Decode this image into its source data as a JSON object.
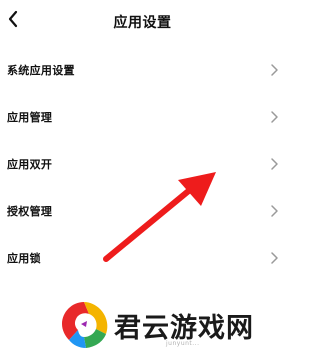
{
  "header": {
    "title": "应用设置",
    "back_icon": "chevron-left-icon"
  },
  "settings": {
    "items": [
      {
        "label": "系统应用设置",
        "icon": "chevron-right-icon"
      },
      {
        "label": "应用管理",
        "icon": "chevron-right-icon"
      },
      {
        "label": "应用双开",
        "icon": "chevron-right-icon"
      },
      {
        "label": "授权管理",
        "icon": "chevron-right-icon"
      },
      {
        "label": "应用锁",
        "icon": "chevron-right-icon"
      }
    ]
  },
  "annotation": {
    "arrow_color": "#ee1c1c",
    "arrow_icon": "red-pointer-arrow"
  },
  "watermark": {
    "brand": "君云游戏网",
    "url": "junyunt...",
    "logo_icon": "junyun-logo-icon",
    "logo_colors": [
      "#e8292a",
      "#f4b400",
      "#34a853",
      "#2196f3",
      "#9c27b0"
    ]
  },
  "colors": {
    "background": "#ffffff",
    "text": "#111111",
    "chevron": "#9a9a9a"
  }
}
